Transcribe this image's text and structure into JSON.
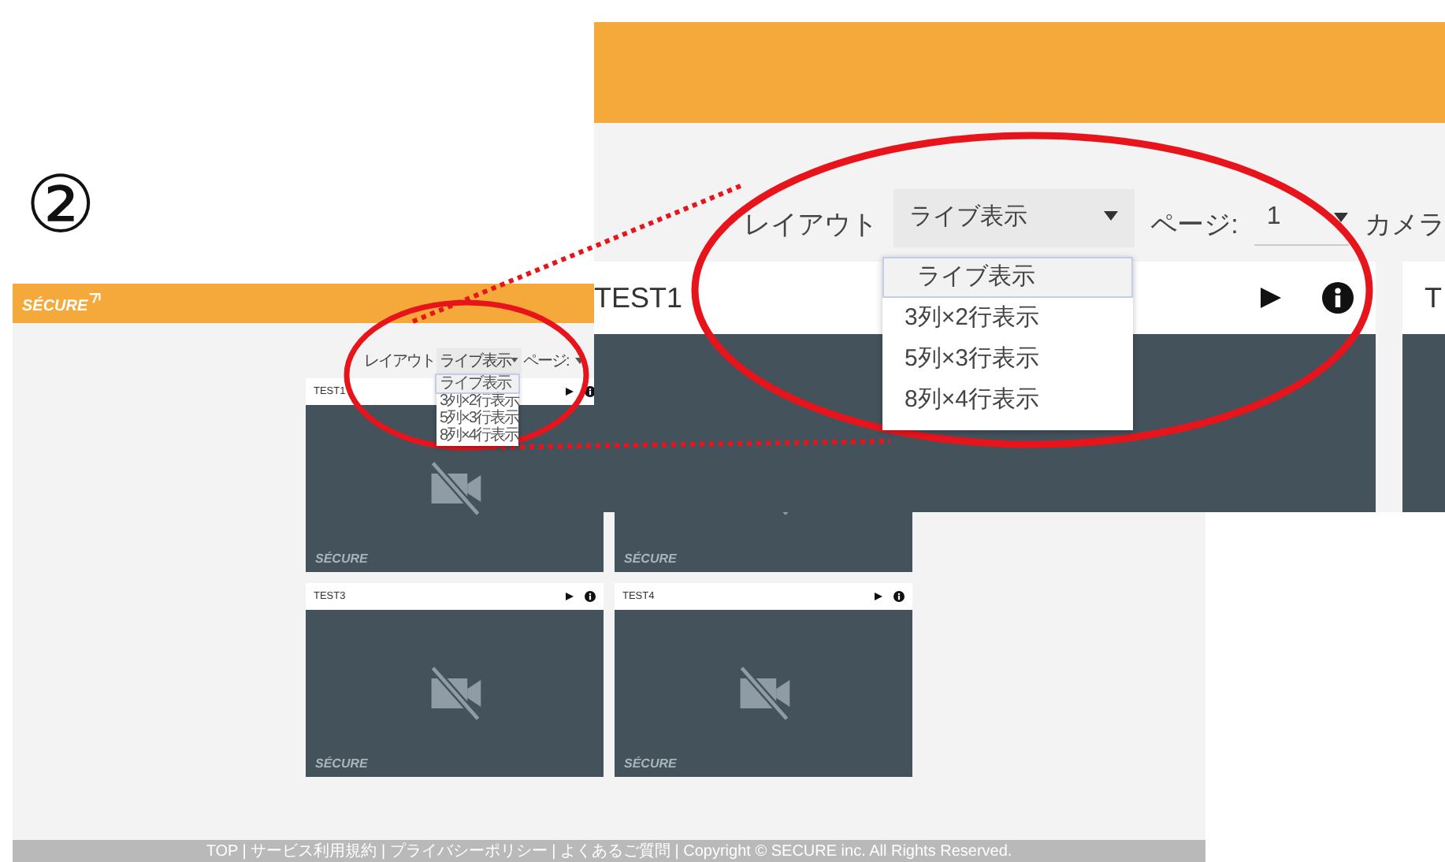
{
  "step_marker": "②",
  "screenshot": {
    "logo": "SÉCURE",
    "toolbar": {
      "layout_label": "レイアウト",
      "layout_value": "ライブ表示",
      "page_label": "ページ:"
    },
    "layout_options": [
      {
        "label": "ライブ表示",
        "selected": true
      },
      {
        "label": "3列×2行表示",
        "selected": false
      },
      {
        "label": "5列×3行表示",
        "selected": false
      },
      {
        "label": "8列×4行表示",
        "selected": false
      }
    ],
    "cameras": [
      {
        "title": "TEST1",
        "watermark": "SÉCURE"
      },
      {
        "watermark": "SÉCURE"
      },
      {
        "title": "TEST3",
        "watermark": "SÉCURE"
      },
      {
        "title": "TEST4",
        "watermark": "SÉCURE"
      }
    ],
    "footer": "TOP | サービス利用規約 | プライバシーポリシー | よくあるご質問 | Copyright © SECURE inc. All Rights Reserved."
  },
  "zoom": {
    "toolbar": {
      "layout_label": "レイアウト",
      "layout_value": "ライブ表示",
      "page_label": "ページ:",
      "page_value": "1",
      "camera_label": "カメラ"
    },
    "layout_options": [
      {
        "label": "ライブ表示",
        "selected": true
      },
      {
        "label": "3列×2行表示",
        "selected": false
      },
      {
        "label": "5列×3行表示",
        "selected": false
      },
      {
        "label": "8列×4行表示",
        "selected": false
      }
    ],
    "cameras": [
      {
        "title": "TEST1"
      },
      {
        "title": "T"
      }
    ]
  }
}
